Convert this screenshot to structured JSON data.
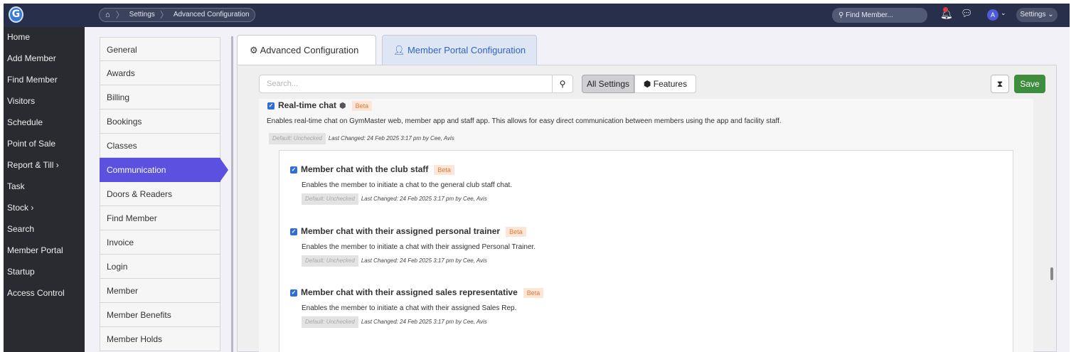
{
  "topbar": {
    "logo": "G",
    "breadcrumb": [
      "Settings",
      "Advanced Configuration"
    ],
    "search_placeholder": "Find Member...",
    "avatar_initial": "A",
    "settings_label": "Settings"
  },
  "sidebar": {
    "items": [
      "Home",
      "Add Member",
      "Find Member",
      "Visitors",
      "Schedule",
      "Point of Sale",
      "Report & Till ›",
      "Task",
      "Stock ›",
      "Search",
      "Member Portal",
      "Startup",
      "Access Control"
    ]
  },
  "settings_menu": {
    "items": [
      "General",
      "Awards",
      "Billing",
      "Bookings",
      "Classes",
      "Communication",
      "Doors & Readers",
      "Find Member",
      "Invoice",
      "Login",
      "Member",
      "Member Benefits",
      "Member Holds"
    ],
    "active": "Communication"
  },
  "tabs": {
    "advanced": "Advanced Configuration",
    "portal": "Member Portal Configuration"
  },
  "toolbar": {
    "search_placeholder": "Search...",
    "all_settings": "All Settings",
    "features": "Features",
    "save": "Save"
  },
  "main_setting": {
    "title": "Real-time chat",
    "badge": "Beta",
    "description": "Enables real-time chat on GymMaster web, member app and staff app. This allows for easy direct communication between members using the app and facility staff.",
    "default": "Default: Unchecked",
    "last_changed": "Last Changed: 24 Feb 2025 3:17 pm by Cee, Avis"
  },
  "sub_settings": [
    {
      "title": "Member chat with the club staff",
      "badge": "Beta",
      "description": "Enables the member to initiate a chat to the general club staff chat.",
      "default": "Default: Unchecked",
      "last_changed": "Last Changed: 24 Feb 2025 3:17 pm by Cee, Avis"
    },
    {
      "title": "Member chat with their assigned personal trainer",
      "badge": "Beta",
      "description": "Enables the member to initiate a chat with their assigned Personal Trainer.",
      "default": "Default: Unchecked",
      "last_changed": "Last Changed: 24 Feb 2025 3:17 pm by Cee, Avis"
    },
    {
      "title": "Member chat with their assigned sales representative",
      "badge": "Beta",
      "description": "Enables the member to initiate a chat with their assigned Sales Rep.",
      "default": "Default: Unchecked",
      "last_changed": "Last Changed: 24 Feb 2025 3:17 pm by Cee, Avis"
    }
  ],
  "colors": {
    "topbar": "#272f4b",
    "sidebar": "#2a2b30",
    "active_item": "#5b50e0",
    "save": "#3e8c3e",
    "checkbox": "#2f6ed6",
    "beta_bg": "#fde6d8"
  }
}
